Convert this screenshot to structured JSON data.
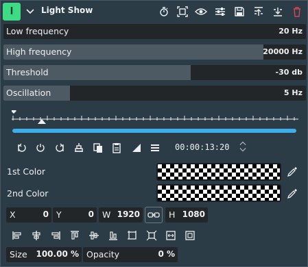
{
  "header": {
    "badge": "l",
    "title": "Light Show",
    "icons": [
      "collapse-chevron-icon",
      "timer-icon",
      "zone-icon",
      "eye-icon",
      "settings-sliders-icon",
      "save-icon",
      "move-up-icon",
      "move-down-icon",
      "delete-icon"
    ]
  },
  "params": [
    {
      "label": "Low frequency",
      "value": "20 Hz",
      "fill_fraction": 0.0
    },
    {
      "label": "High frequency",
      "value": "20000 Hz",
      "fill_fraction": 0.86
    },
    {
      "label": "Threshold",
      "value": "-30 db",
      "fill_fraction": 0.62
    },
    {
      "label": "Oscillation",
      "value": "5 Hz",
      "fill_fraction": 0.22
    }
  ],
  "timeline": {
    "timecode": "00:00:13:20",
    "buttons": [
      "previous-keyframe-icon",
      "add-keyframe-icon",
      "next-keyframe-icon",
      "align-keyframe-icon",
      "copy-keyframe-icon",
      "paste-keyframe-icon",
      "interpolation-icon",
      "menu-icon"
    ]
  },
  "colors": {
    "first_label": "1st Color",
    "second_label": "2nd Color"
  },
  "geometry": {
    "x_label": "X",
    "x_value": "0",
    "y_label": "Y",
    "y_value": "0",
    "w_label": "W",
    "w_value": "1920",
    "h_label": "H",
    "h_value": "1080"
  },
  "align_buttons": [
    "align-left-icon",
    "align-hcenter-icon",
    "align-right-icon",
    "align-top-icon",
    "align-vcenter-icon",
    "align-bottom-icon",
    "fit-frame-icon",
    "adjust-size-icon",
    "fill-width-icon",
    "fill-height-icon"
  ],
  "bottom": {
    "size_label": "Size",
    "size_value": "100.00 %",
    "opacity_label": "Opacity",
    "opacity_value": "0 %"
  },
  "theme": {
    "accent": "#3daee9",
    "badge": "#3ddc84",
    "delete": "#da4453",
    "panel": "#2b3c47"
  }
}
